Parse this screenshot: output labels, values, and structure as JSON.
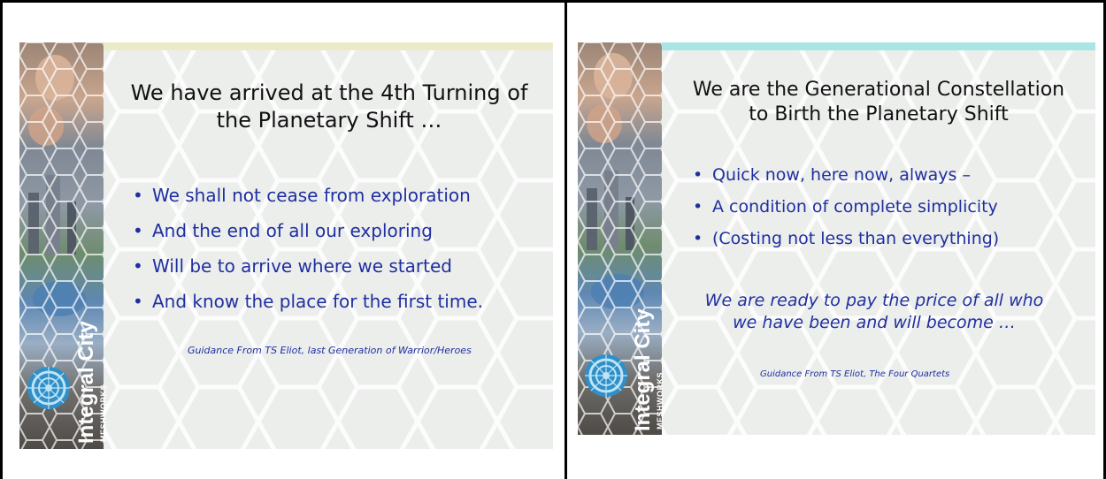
{
  "slides": [
    {
      "title_lines": [
        "We have arrived at the 4th Turning of",
        "the Planetary Shift …"
      ],
      "bullets": [
        "We shall not cease from exploration",
        "And the end of all our exploring",
        "Will be to arrive where we started",
        "And know the place for the first time."
      ],
      "attribution": "Guidance From TS Eliot, last Generation of Warrior/Heroes",
      "brand": "Integral City",
      "brand_sub": "MESHWORKS"
    },
    {
      "title_lines": [
        "We are the Generational Constellation",
        "to Birth the Planetary Shift"
      ],
      "bullets": [
        "Quick now, here now, always –",
        "A condition of complete simplicity",
        "(Costing not less than everything)"
      ],
      "quote_lines": [
        "We are ready to pay the price of all who",
        "we have been and will become …"
      ],
      "attribution": "Guidance From TS Eliot, The Four Quartets",
      "brand": "Integral City",
      "brand_sub": "MESHWORKS"
    }
  ],
  "colors": {
    "text_blue": "#1f2fa0",
    "slide_bg": "#eef0ee",
    "band_left": "#ecebc9",
    "band_right": "#a8e6e6",
    "logo_blue": "#2f8fc8"
  }
}
